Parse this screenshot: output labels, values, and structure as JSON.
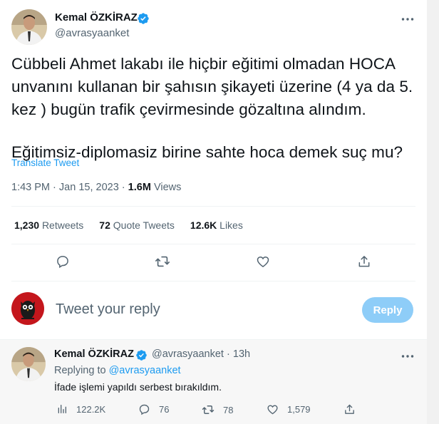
{
  "tweet": {
    "author_name": "Kemal ÖZKİRAZ",
    "author_handle": "@avrasyaanket",
    "text_lines": [
      "Cübbeli Ahmet lakabı ile hiçbir eğitimi olmadan HOCA",
      "unvanını kullanan bir şahısın şikayeti üzerine (4 ya da 5.",
      "kez ) bugün trafik çevirmesinde gözaltına alındım.",
      "Eğitimsiz-diplomasiz birine sahte hoca demek suç mu?"
    ],
    "translate_label": "Translate Tweet",
    "time": "1:43 PM",
    "separator": "·",
    "date": "Jan 15, 2023",
    "views_count": "1.6M",
    "views_label": "Views"
  },
  "stats": {
    "retweets_count": "1,230",
    "retweets_label": "Retweets",
    "quotes_count": "72",
    "quotes_label": "Quote Tweets",
    "likes_count": "12.6K",
    "likes_label": "Likes"
  },
  "actions": [
    "reply-icon",
    "retweet-icon",
    "like-icon",
    "share-icon"
  ],
  "composer": {
    "placeholder": "Tweet your reply",
    "reply_button": "Reply"
  },
  "reply": {
    "author_name": "Kemal ÖZKİRAZ",
    "author_handle": "@avrasyaanket",
    "separator": "·",
    "age": "13h",
    "replying_prefix": "Replying to",
    "replying_handle": "@avrasyaanket",
    "text": "İfade işlemi yapıldı serbest bırakıldım.",
    "views": "122.2K",
    "replies": "76",
    "retweets": "78",
    "likes": "1,579"
  },
  "colors": {
    "accent": "#1d9bf0",
    "reply_button_disabled": "#8ecdf8",
    "secondary_text": "#536471",
    "owl_avatar_bg": "#c4161c"
  }
}
